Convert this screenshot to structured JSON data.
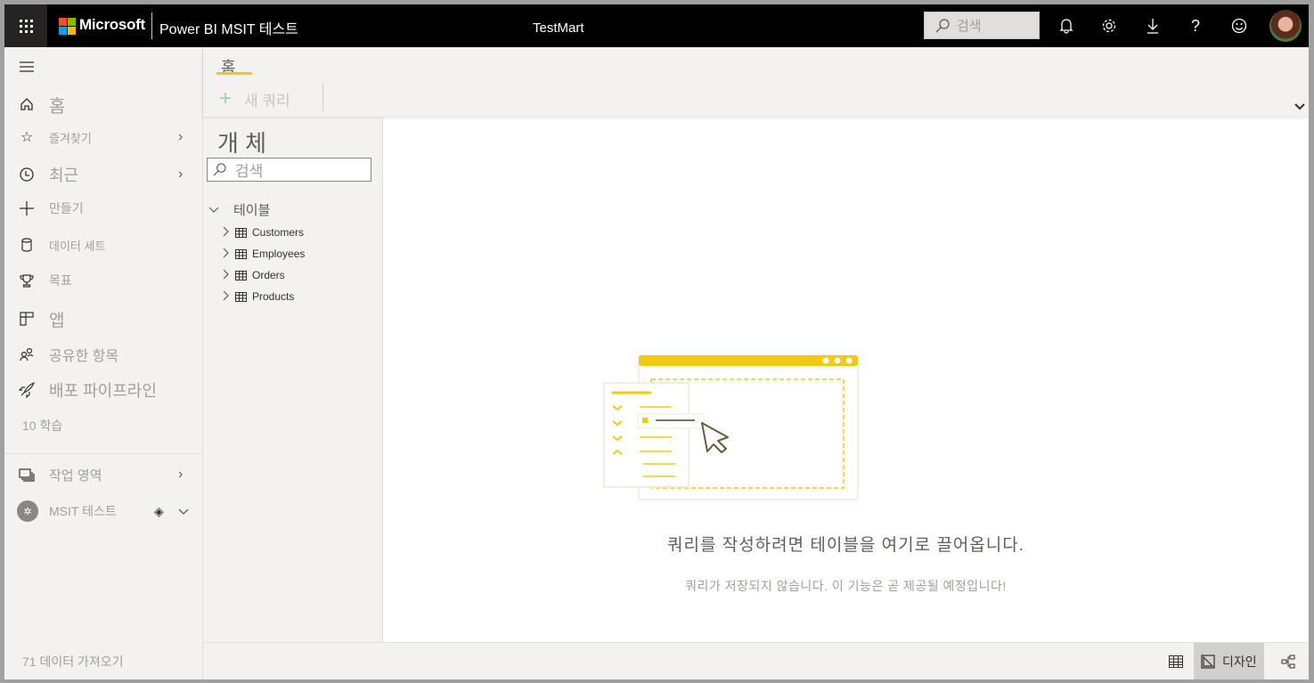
{
  "topbar": {
    "waffle_label": "앱 시작 관리자",
    "brand": "Microsoft",
    "app_title": "Power BI MSIT 테스트",
    "report_title": "TestMart",
    "search_placeholder": "검색",
    "icons": [
      "bell-icon",
      "gear-icon",
      "download-icon",
      "help-icon",
      "smiley-icon",
      "avatar"
    ],
    "help_glyph": "?"
  },
  "nav": {
    "items": [
      {
        "label": "홈",
        "icon": "home-icon"
      },
      {
        "label": "즐겨찾기",
        "icon": "star-icon",
        "chevron": true
      },
      {
        "label": "최근",
        "icon": "clock-icon",
        "chevron": true
      },
      {
        "label": "만들기",
        "icon": "plus-icon"
      },
      {
        "label": "데이터 세트",
        "icon": "database-icon"
      },
      {
        "label": "목표",
        "icon": "trophy-icon"
      },
      {
        "label": "앱",
        "icon": "apps-icon"
      },
      {
        "label": "공유한 항목",
        "icon": "shared-icon"
      },
      {
        "label": "배포 파이프라인",
        "icon": "rocket-icon"
      },
      {
        "label": "10 학습"
      },
      {
        "label": "작업 영역",
        "icon": "workspaces-icon",
        "chevron": true
      },
      {
        "label": "MSIT 테스트",
        "icon": "workspace-avatar",
        "chevron": true
      }
    ],
    "get_data": "71 데이터 가져오기"
  },
  "ribbon": {
    "tab": "홈",
    "new_query": "새 쿼리",
    "plus": "+",
    "accent": "#f2c811"
  },
  "objects": {
    "title": "개 체",
    "search_placeholder": "검색",
    "group": "테이블",
    "tables": [
      "Customers",
      "Employees",
      "Orders",
      "Products"
    ]
  },
  "canvas": {
    "message": "쿼리를 작성하려면 테이블을 여기로 끌어옵니다.",
    "sub_message": "쿼리가 저장되지 않습니다. 이 기능은 곧 제공될 예정입니다!"
  },
  "views": {
    "design_label": "디자인",
    "active": "design"
  },
  "glyphs": {
    "chevron_right": "›",
    "chevron_down": "⌄"
  }
}
